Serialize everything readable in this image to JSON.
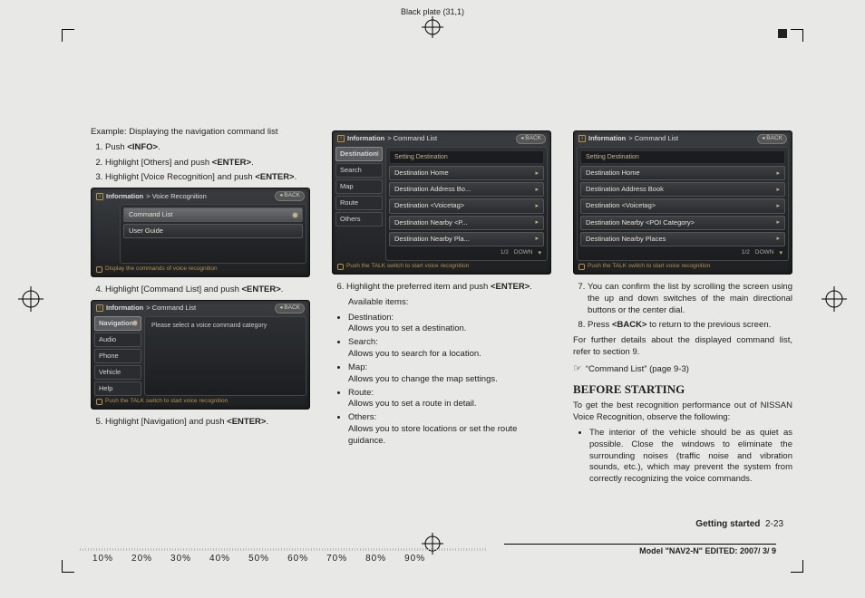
{
  "plate_header": "Black plate (31,1)",
  "col1": {
    "example": "Example: Displaying the navigation command list",
    "step1_pre": "Push ",
    "step1_btn": "<INFO>",
    "step1_post": ".",
    "step2": "Highlight [Others] and push ",
    "step2_btn": "<ENTER>",
    "step2_post": ".",
    "step3": "Highlight [Voice Recognition] and push ",
    "step3_btn": "<ENTER>",
    "step3_post": ".",
    "step4": "Highlight [Command List] and push ",
    "step4_btn": "<ENTER>",
    "step4_post": ".",
    "step5": "Highlight [Navigation] and push ",
    "step5_btn": "<ENTER>",
    "step5_post": "."
  },
  "device1": {
    "title_a": "Information",
    "title_b": "> Voice Recognition",
    "back": "BACK",
    "rows": [
      "Command List",
      "User Guide"
    ],
    "footer": "Display the commands of voice recognition"
  },
  "device2": {
    "title_a": "Information",
    "title_b": "> Command List",
    "back": "BACK",
    "tabs": [
      "Navigation",
      "Audio",
      "Phone",
      "Vehicle",
      "Help"
    ],
    "note": "Please select a voice command category",
    "footer": "Push the TALK switch to start voice recognition"
  },
  "device3": {
    "title_a": "Information",
    "title_b": "> Command List",
    "back": "BACK",
    "tabs": [
      "Destination",
      "Search",
      "Map",
      "Route",
      "Others"
    ],
    "header_row": "Setting Destination",
    "rows": [
      "Destination Home",
      "Destination Address Bo...",
      "Destination <Voicetag>",
      "Destination Nearby <P...",
      "Destination Nearby Pla..."
    ],
    "pager": "1/2",
    "pager_label": "DOWN",
    "footer": "Push the TALK switch to start voice recognition"
  },
  "col2": {
    "step6": "Highlight the preferred item and push ",
    "step6_btn": "<ENTER>",
    "step6_post": ".",
    "avail_label": "Available items:",
    "items": [
      {
        "name": "Destination:",
        "desc": "Allows you to set a destination."
      },
      {
        "name": "Search:",
        "desc": "Allows you to search for a location."
      },
      {
        "name": "Map:",
        "desc": "Allows you to change the map settings."
      },
      {
        "name": "Route:",
        "desc": "Allows you to set a route in detail."
      },
      {
        "name": "Others:",
        "desc": "Allows you to store locations or set the route guidance."
      }
    ]
  },
  "device4": {
    "title_a": "Information",
    "title_b": "> Command List",
    "back": "BACK",
    "header_row": "Setting Destination",
    "rows": [
      "Destination Home",
      "Destination Address Book",
      "Destination <Voicetag>",
      "Destination Nearby <POI Category>",
      "Destination Nearby Places"
    ],
    "pager": "1/2",
    "pager_label": "DOWN",
    "footer": "Push the TALK switch to start voice recognition"
  },
  "col3": {
    "step7": "You can confirm the list by scrolling the screen using the up and down switches of the main directional buttons or the center dial.",
    "step8_pre": "Press ",
    "step8_btn": "<BACK>",
    "step8_post": " to return to the previous screen.",
    "further": "For further details about the displayed command list, refer to section 9.",
    "crossref": "“Command List” (page 9-3)",
    "heading": "BEFORE STARTING",
    "intro": "To get the best recognition performance out of NISSAN Voice Recognition, observe the following:",
    "bullet1": "The interior of the vehicle should be as quiet as possible. Close the windows to eliminate the surrounding noises (traffic noise and vibration sounds, etc.), which may prevent the system from correctly recognizing the voice commands."
  },
  "footer": {
    "section": "Getting started",
    "page": "2-23",
    "model": "Model \"NAV2-N\" EDITED: 2007/ 3/ 9",
    "pcts": [
      "10%",
      "20%",
      "30%",
      "40%",
      "50%",
      "60%",
      "70%",
      "80%",
      "90%"
    ]
  }
}
